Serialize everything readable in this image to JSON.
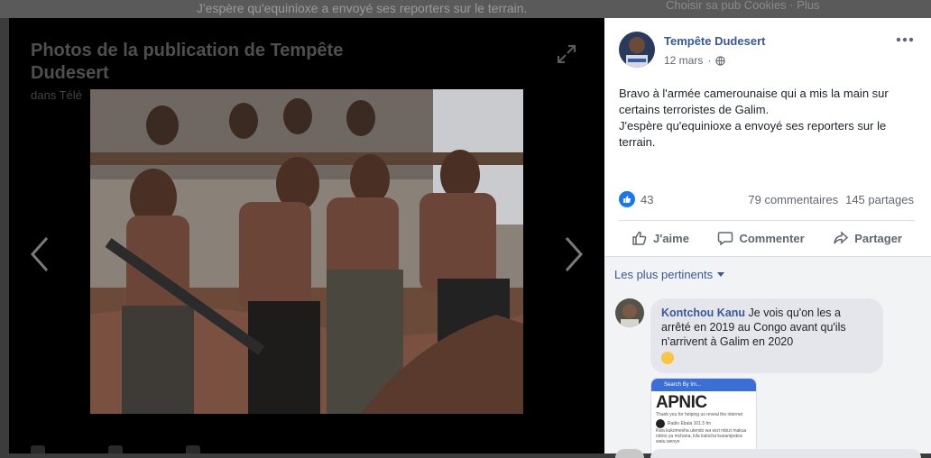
{
  "background": {
    "text_left": "J'espère qu'equinioxe a envoyé ses reporters sur le terrain.",
    "text_right": "Choisir sa pub   Cookies · Plus"
  },
  "viewer": {
    "title": "Photos de la publication de Tempête Dudesert",
    "subtitle": "dans Télé",
    "expand_icon": "expand-arrows-icon",
    "prev_icon": "chevron-left-icon",
    "next_icon": "chevron-right-icon",
    "photo_description_icon": "photo"
  },
  "post": {
    "author": "Tempête Dudesert",
    "time": "12 mars",
    "separator": "·",
    "privacy_icon": "globe-icon",
    "more_icon": "ellipsis-icon",
    "text": [
      "Bravo à l'armée camerounaise qui a mis la main sur certains terroristes de Galim.",
      "J'espère qu'equinioxe a envoyé ses reporters sur le terrain."
    ],
    "reactions_count": "43",
    "comments_count": "79 commentaires",
    "shares_count": "145 partages"
  },
  "actions": {
    "like": "J'aime",
    "comment": "Commenter",
    "share": "Partager"
  },
  "comments": {
    "sort_label": "Les plus pertinents",
    "items": [
      {
        "name": "Kontchou Kanu",
        "text": "Je vois qu'on les a arrêté en 2019 au Congo avant qu'ils n'arrivent à Galim en 2020"
      }
    ],
    "attachment": {
      "bar_text": "Search By Im...",
      "brand": "APNIC",
      "line1": "Thank you for helping us reveal the internet",
      "line2": "Radio Ebala 101.5 fm",
      "line3": "Kwa kukomesha utendo wa wizi mbizi makua ndoto ya mchana, kila kukicha kunanipotea watu wenye"
    },
    "colors": {
      "link": "#385898",
      "bubble": "#e4e6eb",
      "like": "#1877f2"
    }
  }
}
